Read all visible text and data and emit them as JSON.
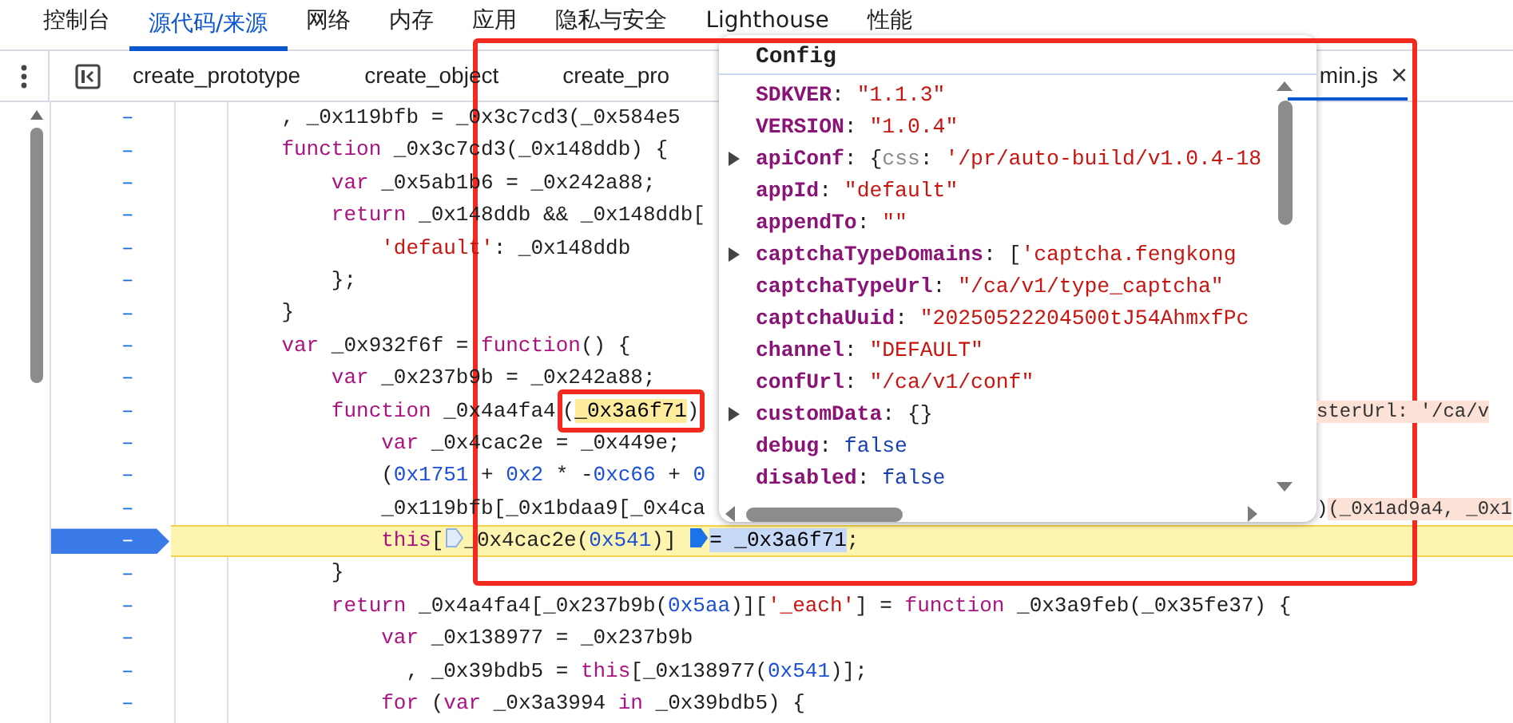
{
  "main_tabs": [
    {
      "label": "控制台",
      "selected": false
    },
    {
      "label": "源代码/来源",
      "selected": true
    },
    {
      "label": "网络",
      "selected": false
    },
    {
      "label": "内存",
      "selected": false
    },
    {
      "label": "应用",
      "selected": false
    },
    {
      "label": "隐私与安全",
      "selected": false
    },
    {
      "label": "Lighthouse",
      "selected": false
    },
    {
      "label": "性能",
      "selected": false
    }
  ],
  "file_tabs": [
    {
      "label": "create_prototype",
      "selected": false
    },
    {
      "label": "create_object",
      "selected": false
    },
    {
      "label": "create_pro",
      "selected": false
    },
    {
      "label": "min.js",
      "selected": true,
      "close": "×"
    }
  ],
  "code_lines": [
    {
      "gutter": "–",
      "paused": false,
      "parts": [
        {
          "kind": "txt",
          "text": "    , _0x119bfb = _0x3c7cd3(_0x584e5"
        }
      ]
    },
    {
      "gutter": "–",
      "paused": false,
      "parts": [
        {
          "kind": "kw",
          "text": "    function"
        },
        {
          "kind": "txt",
          "text": " _0x3c7cd3(_0x148ddb) {"
        }
      ]
    },
    {
      "gutter": "–",
      "paused": false,
      "parts": [
        {
          "kind": "kw",
          "text": "        var"
        },
        {
          "kind": "txt",
          "text": " _0x5ab1b6 = _0x242a88;"
        }
      ]
    },
    {
      "gutter": "–",
      "paused": false,
      "parts": [
        {
          "kind": "kw",
          "text": "        return"
        },
        {
          "kind": "txt",
          "text": " _0x148ddb && _0x148ddb["
        }
      ]
    },
    {
      "gutter": "–",
      "paused": false,
      "parts": [
        {
          "kind": "str",
          "text": "            'default'"
        },
        {
          "kind": "txt",
          "text": ": _0x148ddb"
        }
      ]
    },
    {
      "gutter": "–",
      "paused": false,
      "parts": [
        {
          "kind": "txt",
          "text": "        };"
        }
      ]
    },
    {
      "gutter": "–",
      "paused": false,
      "parts": [
        {
          "kind": "txt",
          "text": "    }"
        }
      ]
    },
    {
      "gutter": "–",
      "paused": false,
      "parts": [
        {
          "kind": "kw",
          "text": "    var"
        },
        {
          "kind": "txt",
          "text": " _0x932f6f = "
        },
        {
          "kind": "kw",
          "text": "function"
        },
        {
          "kind": "txt",
          "text": "() {"
        }
      ]
    },
    {
      "gutter": "–",
      "paused": false,
      "parts": [
        {
          "kind": "kw",
          "text": "        var"
        },
        {
          "kind": "txt",
          "text": " _0x237b9b = _0x242a88;"
        }
      ]
    },
    {
      "gutter": "–",
      "paused": false,
      "parts": [
        {
          "kind": "kw",
          "text": "        function"
        },
        {
          "kind": "txt",
          "text": " _0x4a4fa4"
        },
        {
          "kind": "framed",
          "parts": [
            {
              "kind": "txt",
              "text": "("
            },
            {
              "kind": "match",
              "text": "_0x3a6f71"
            },
            {
              "kind": "txt",
              "text": ")"
            }
          ]
        }
      ],
      "tail": [
        {
          "kind": "inline",
          "text": "sterUrl: '/ca/v"
        }
      ]
    },
    {
      "gutter": "–",
      "paused": false,
      "parts": [
        {
          "kind": "kw",
          "text": "            var"
        },
        {
          "kind": "txt",
          "text": " _0x4cac2e = _0x449e;"
        }
      ]
    },
    {
      "gutter": "–",
      "paused": false,
      "parts": [
        {
          "kind": "txt",
          "text": "            ("
        },
        {
          "kind": "num",
          "text": "0x1751"
        },
        {
          "kind": "txt",
          "text": " + "
        },
        {
          "kind": "num",
          "text": "0x2"
        },
        {
          "kind": "txt",
          "text": " * -"
        },
        {
          "kind": "num",
          "text": "0xc66"
        },
        {
          "kind": "txt",
          "text": " + "
        },
        {
          "kind": "num",
          "text": "0"
        }
      ]
    },
    {
      "gutter": "–",
      "paused": false,
      "parts": [
        {
          "kind": "txt",
          "text": "            _0x119bfb[_0x1bdaa9[_0x4ca"
        }
      ],
      "tail": [
        {
          "kind": "txt",
          "text": ")"
        },
        {
          "kind": "inline",
          "text": "(_0x1ad9a4, _0x1"
        }
      ]
    },
    {
      "gutter": "–",
      "paused": true,
      "parts": [
        {
          "kind": "kw",
          "text": "            this"
        },
        {
          "kind": "txt",
          "text": "["
        },
        {
          "kind": "bp",
          "active": false
        },
        {
          "kind": "txt",
          "text": "_0x4cac2e("
        },
        {
          "kind": "num",
          "text": "0x541"
        },
        {
          "kind": "txt",
          "text": ")] "
        },
        {
          "kind": "bp",
          "active": true
        },
        {
          "kind": "sel",
          "text": "= _0x3a6f71"
        },
        {
          "kind": "txt",
          "text": ";"
        }
      ]
    },
    {
      "gutter": "–",
      "paused": false,
      "parts": [
        {
          "kind": "txt",
          "text": "        }"
        }
      ]
    },
    {
      "gutter": "–",
      "paused": false,
      "parts": [
        {
          "kind": "kw",
          "text": "        return"
        },
        {
          "kind": "txt",
          "text": " _0x4a4fa4[_0x237b9b("
        },
        {
          "kind": "num",
          "text": "0x5aa"
        },
        {
          "kind": "txt",
          "text": ")]["
        },
        {
          "kind": "str",
          "text": "'_each'"
        },
        {
          "kind": "txt",
          "text": "] = "
        },
        {
          "kind": "kw",
          "text": "function"
        },
        {
          "kind": "txt",
          "text": " _0x3a9feb(_0x35fe37) {"
        }
      ]
    },
    {
      "gutter": "–",
      "paused": false,
      "parts": [
        {
          "kind": "kw",
          "text": "            var"
        },
        {
          "kind": "txt",
          "text": " _0x138977 = _0x237b9b"
        }
      ]
    },
    {
      "gutter": "–",
      "paused": false,
      "parts": [
        {
          "kind": "txt",
          "text": "              , _0x39bdb5 = "
        },
        {
          "kind": "kw",
          "text": "this"
        },
        {
          "kind": "txt",
          "text": "[_0x138977("
        },
        {
          "kind": "num",
          "text": "0x541"
        },
        {
          "kind": "txt",
          "text": ")];"
        }
      ]
    },
    {
      "gutter": "–",
      "paused": false,
      "parts": [
        {
          "kind": "kw",
          "text": "            for"
        },
        {
          "kind": "txt",
          "text": " ("
        },
        {
          "kind": "kw",
          "text": "var"
        },
        {
          "kind": "txt",
          "text": " _0x3a3994 "
        },
        {
          "kind": "kw",
          "text": "in"
        },
        {
          "kind": "txt",
          "text": " _0x39bdb5) {"
        }
      ]
    }
  ],
  "popover": {
    "title": "Config",
    "properties": [
      {
        "expandable": false,
        "parts": [
          {
            "kind": "key",
            "text": "SDKVER"
          },
          {
            "kind": "txt",
            "text": ": "
          },
          {
            "kind": "str",
            "text": "\"1.1.3\""
          }
        ]
      },
      {
        "expandable": false,
        "parts": [
          {
            "kind": "key",
            "text": "VERSION"
          },
          {
            "kind": "txt",
            "text": ": "
          },
          {
            "kind": "str",
            "text": "\"1.0.4\""
          }
        ]
      },
      {
        "expandable": true,
        "parts": [
          {
            "kind": "key",
            "text": "apiConf"
          },
          {
            "kind": "txt",
            "text": ": {"
          },
          {
            "kind": "dim",
            "text": "css"
          },
          {
            "kind": "txt",
            "text": ": "
          },
          {
            "kind": "str",
            "text": "'/pr/auto-build/v1.0.4-18"
          }
        ]
      },
      {
        "expandable": false,
        "parts": [
          {
            "kind": "key",
            "text": "appId"
          },
          {
            "kind": "txt",
            "text": ": "
          },
          {
            "kind": "str",
            "text": "\"default\""
          }
        ]
      },
      {
        "expandable": false,
        "parts": [
          {
            "kind": "key",
            "text": "appendTo"
          },
          {
            "kind": "txt",
            "text": ": "
          },
          {
            "kind": "str",
            "text": "\"\""
          }
        ]
      },
      {
        "expandable": true,
        "parts": [
          {
            "kind": "key",
            "text": "captchaTypeDomains"
          },
          {
            "kind": "txt",
            "text": ": ["
          },
          {
            "kind": "str",
            "text": "'captcha.fengkong"
          }
        ]
      },
      {
        "expandable": false,
        "parts": [
          {
            "kind": "key",
            "text": "captchaTypeUrl"
          },
          {
            "kind": "txt",
            "text": ": "
          },
          {
            "kind": "str",
            "text": "\"/ca/v1/type_captcha\""
          }
        ]
      },
      {
        "expandable": false,
        "parts": [
          {
            "kind": "key",
            "text": "captchaUuid"
          },
          {
            "kind": "txt",
            "text": ": "
          },
          {
            "kind": "str",
            "text": "\"20250522204500tJ54AhmxfPc"
          }
        ]
      },
      {
        "expandable": false,
        "parts": [
          {
            "kind": "key",
            "text": "channel"
          },
          {
            "kind": "txt",
            "text": ": "
          },
          {
            "kind": "str",
            "text": "\"DEFAULT\""
          }
        ]
      },
      {
        "expandable": false,
        "parts": [
          {
            "kind": "key",
            "text": "confUrl"
          },
          {
            "kind": "txt",
            "text": ": "
          },
          {
            "kind": "str",
            "text": "\"/ca/v1/conf\""
          }
        ]
      },
      {
        "expandable": true,
        "parts": [
          {
            "kind": "key",
            "text": "customData"
          },
          {
            "kind": "txt",
            "text": ": {}"
          }
        ]
      },
      {
        "expandable": false,
        "parts": [
          {
            "kind": "key",
            "text": "debug"
          },
          {
            "kind": "txt",
            "text": ": "
          },
          {
            "kind": "bool",
            "text": "false"
          }
        ]
      },
      {
        "expandable": false,
        "parts": [
          {
            "kind": "key",
            "text": "disabled"
          },
          {
            "kind": "txt",
            "text": ": "
          },
          {
            "kind": "bool",
            "text": "false"
          }
        ]
      }
    ]
  },
  "annotation_frames": [
    {
      "kind": "rectangle"
    }
  ]
}
